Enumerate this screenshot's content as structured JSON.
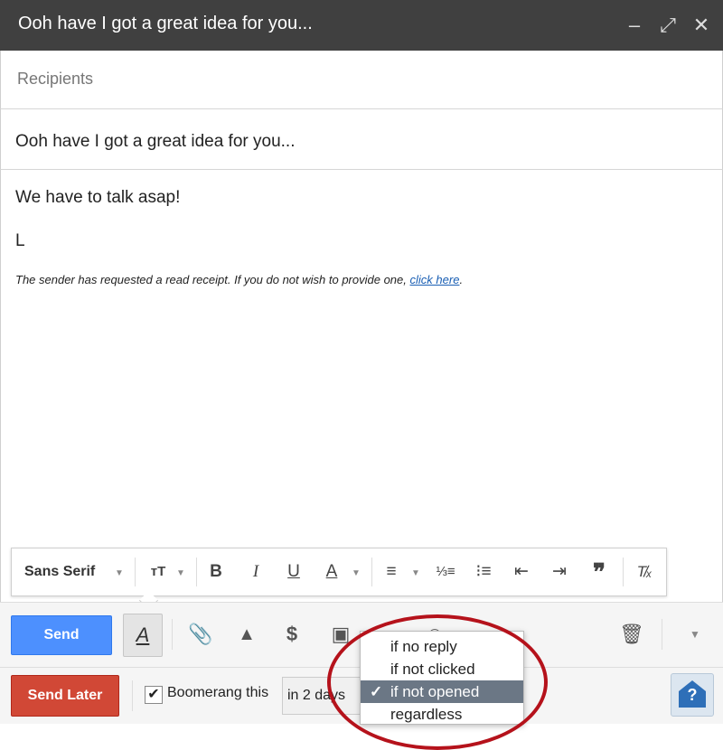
{
  "window": {
    "title": "Ooh have I got a great idea for you...",
    "controls": [
      "minimize-icon",
      "expand-icon",
      "close-icon"
    ]
  },
  "recipients": {
    "placeholder": "Recipients",
    "value": ""
  },
  "subject": {
    "value": "Ooh have I got a great idea for you..."
  },
  "body": {
    "line1": "We have to talk asap!",
    "line2": "L",
    "receipt_text": "The sender has requested a read receipt. If you do not wish to provide one,",
    "receipt_link": "click here",
    "receipt_end": "."
  },
  "format_toolbar": {
    "font": "Sans Serif",
    "icons": [
      "font-size-icon",
      "bold-icon",
      "italic-icon",
      "underline-icon",
      "text-color-icon",
      "align-icon",
      "numbered-list-icon",
      "bulleted-list-icon",
      "indent-less-icon",
      "indent-more-icon",
      "quote-icon",
      "remove-formatting-icon"
    ]
  },
  "bottom_toolbar": {
    "send_label": "Send",
    "icons": [
      "formatting-icon",
      "attach-icon",
      "drive-icon",
      "money-icon",
      "photo-icon",
      "link-icon",
      "emoji-icon",
      "trash-icon",
      "more-options-icon"
    ]
  },
  "boomerang": {
    "send_later_label": "Send Later",
    "checkbox_label": "Boomerang this",
    "checked": true,
    "delay": "in 2 days",
    "condition_options": [
      "if no reply",
      "if not clicked",
      "if not opened",
      "regardless"
    ],
    "selected_condition": "if not opened"
  },
  "colors": {
    "titlebar": "#404040",
    "send_button": "#4d90fe",
    "send_later_button": "#d14836",
    "highlight_oval": "#b5121b",
    "selected_option": "#6b7785"
  }
}
